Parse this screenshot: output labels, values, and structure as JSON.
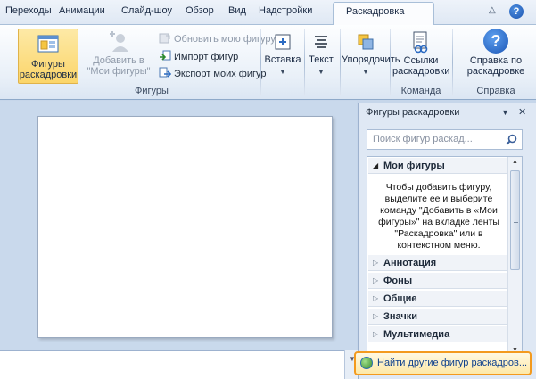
{
  "tabs": [
    {
      "label": "Переходы"
    },
    {
      "label": "Анимации"
    },
    {
      "label": "Слайд-шоу"
    },
    {
      "label": "Обзор"
    },
    {
      "label": "Вид"
    },
    {
      "label": "Надстройки"
    },
    {
      "label": "Раскадровка",
      "active": true
    }
  ],
  "ribbon": {
    "shapes_group": {
      "label": "Фигуры",
      "storyboard_shapes": "Фигуры раскадровки",
      "add_to_my_shapes": "Добавить в \"Мои фигуры\"",
      "update_my_shape": "Обновить мою фигуру",
      "import_shapes": "Импорт фигур",
      "export_my_shapes": "Экспорт моих фигур"
    },
    "insert": "Вставка",
    "text": "Текст",
    "arrange": "Упорядочить",
    "team_group": {
      "label": "Команда",
      "storyboard_links": "Ссылки раскадровки"
    },
    "help_group": {
      "label": "Справка",
      "storyboard_help": "Справка по раскадровке"
    }
  },
  "pane": {
    "title": "Фигуры раскадровки",
    "search_placeholder": "Поиск фигур раскад...",
    "categories": [
      {
        "label": "Мои фигуры",
        "expanded": true
      },
      {
        "label": "Аннотация",
        "expanded": false
      },
      {
        "label": "Фоны",
        "expanded": false
      },
      {
        "label": "Общие",
        "expanded": false
      },
      {
        "label": "Значки",
        "expanded": false
      },
      {
        "label": "Мультимедиа",
        "expanded": false
      }
    ],
    "my_shapes_hint": "Чтобы добавить фигуру, выделите ее и выберите команду \"Добавить в «Мои фигуры»\" на вкладке ленты \"Раскадровка\" или в контекстном меню.",
    "find_more": "Найти другие фигур раскадров..."
  },
  "colors": {
    "accent_orange": "#f39a1e",
    "link_blue": "#0d3f8c",
    "ribbon_bg": "#e9f0f8"
  }
}
